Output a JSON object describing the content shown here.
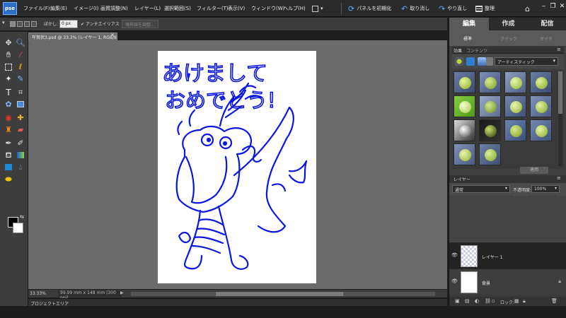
{
  "app": {
    "logo_text": "pse"
  },
  "menu": {
    "items": [
      "ファイル(F)",
      "編集(E)",
      "イメージ(I)",
      "画質調整(N)",
      "レイヤー(L)",
      "選択範囲(S)",
      "フィルター(T)",
      "表示(V)",
      "ウィンドウ(W)",
      "ヘルプ(H)"
    ],
    "reset_panels": "パネルを初期化",
    "undo": "取り消し",
    "redo": "やり直し",
    "organize": "整理"
  },
  "options_bar": {
    "feather_label": "ぼかし:",
    "feather_value": "0 px",
    "antialias_label": "アンチエイリアス",
    "refine_edge": "境界線を調整..."
  },
  "document": {
    "tab_title": "年賀状3.psd @ 33.3% (レイヤー 1, RGB/8) *",
    "zoom": "33.33%",
    "size_info": "99.99 mm x 148 mm (300 ppi)"
  },
  "drawing_text": {
    "line1": "あけまして",
    "line2": "おめでとう!"
  },
  "project_area": {
    "label": "プロジェクトエリア"
  },
  "right_panel": {
    "tabs": [
      "編集",
      "作成",
      "配信"
    ],
    "subtabs": [
      "標準",
      "クイック",
      "ガイド"
    ],
    "effects_tabs": [
      "効果",
      "コンテンツ"
    ],
    "effects_dropdown": "アーティスティック",
    "apply_button": "適用",
    "layers_title": "レイヤー",
    "blend_mode": "通常",
    "opacity_label": "不透明度:",
    "opacity_value": "100%",
    "lock_label": "ロック:",
    "layers": [
      {
        "name": "レイヤー 1"
      },
      {
        "name": "背景"
      }
    ]
  },
  "colors": {
    "ink": "#0b17e0",
    "accent_blue": "#2f6ec8",
    "canvas_bg": "#6b6b6b",
    "apple_green": "#b7d83a"
  },
  "icons": {
    "toolbox": [
      "move-icon",
      "zoom-icon",
      "hand-icon",
      "eyedropper-icon",
      "marquee-icon",
      "lasso-icon",
      "magic-wand-icon",
      "quick-selection-icon",
      "type-icon",
      "crop-icon",
      "cookie-cutter-icon",
      "recompose-icon",
      "red-eye-icon",
      "spot-healing-icon",
      "clone-stamp-icon",
      "eraser-icon",
      "brush-icon",
      "smart-brush-icon",
      "paint-bucket-icon",
      "gradient-icon",
      "shape-icon",
      "blur-icon",
      "sponge-icon"
    ]
  }
}
